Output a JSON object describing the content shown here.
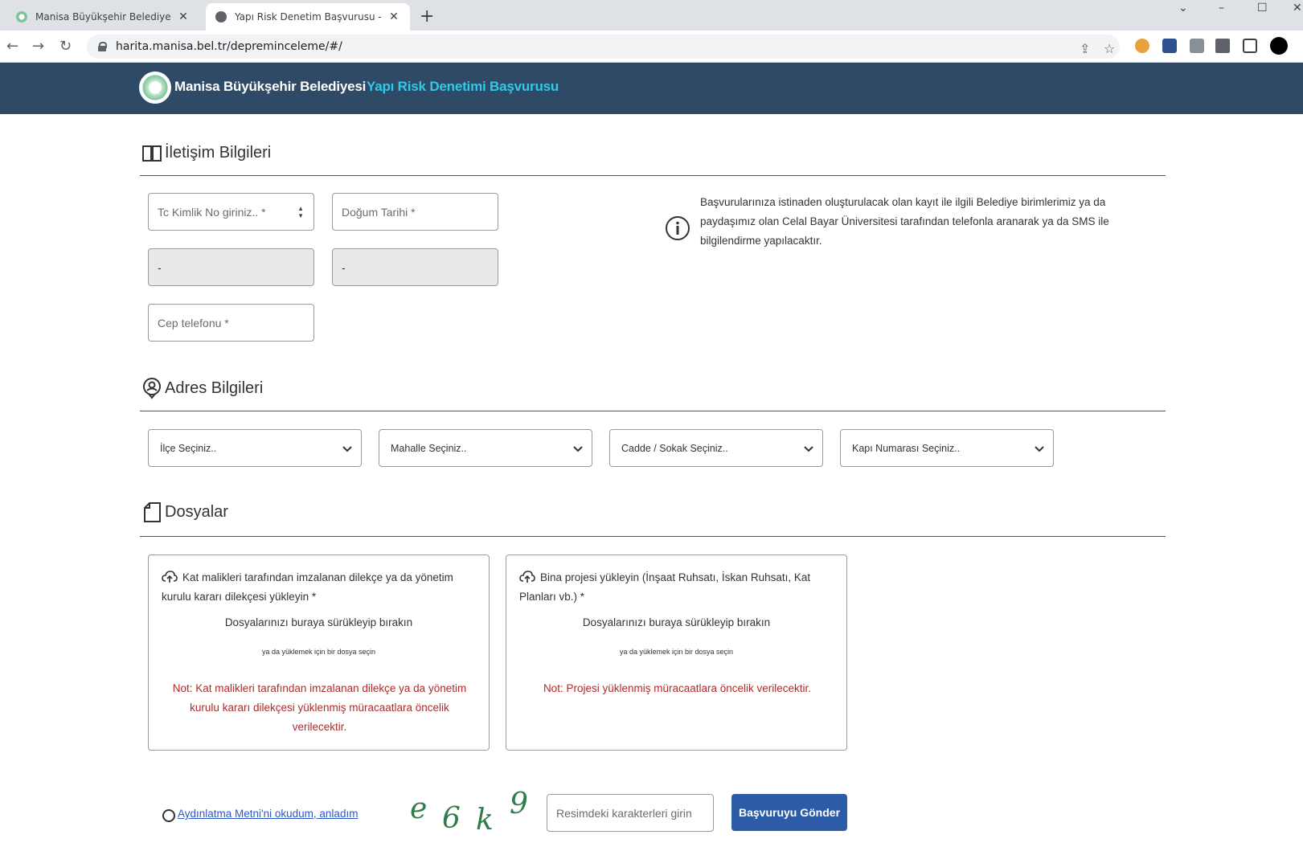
{
  "browser": {
    "tabs": [
      {
        "title": "Manisa Büyükşehir Belediyesi"
      },
      {
        "title": "Yapı Risk Denetim Başvurusu - M"
      }
    ],
    "new_tab": "+",
    "url": "harita.manisa.bel.tr/depreminceleme/#/"
  },
  "header": {
    "brand": "Manisa Büyükşehir Belediyesi",
    "subtitle": "Yapı Risk Denetimi Başvurusu",
    "colors": {
      "bar": "#2e4a66",
      "accent": "#35c7e8"
    }
  },
  "contact": {
    "title": "İletişim Bilgileri",
    "tc_placeholder": "Tc Kimlik No giriniz.. *",
    "birth_placeholder": "Doğum Tarihi *",
    "readonly1": "-",
    "readonly2": "-",
    "phone_placeholder": "Cep telefonu *",
    "info": "Başvurularınıza istinaden oluşturulacak olan kayıt ile ilgili Belediye birimlerimiz ya da paydaşımız olan Celal Bayar Üniversitesi tarafından telefonla aranarak ya da SMS ile bilgilendirme yapılacaktır."
  },
  "address": {
    "title": "Adres Bilgileri",
    "selects": [
      "İlçe Seçiniz..",
      "Mahalle Seçiniz..",
      "Cadde / Sokak Seçiniz..",
      "Kapı Numarası Seçiniz.."
    ]
  },
  "files": {
    "title": "Dosyalar",
    "boxes": [
      {
        "label": "Kat malikleri tarafından imzalanan dilekçe ya da yönetim kurulu kararı dilekçesi yükleyin *",
        "drop": "Dosyalarınızı buraya sürükleyip bırakın",
        "choose": "ya da yüklemek için bir dosya seçin",
        "note": "Not: Kat malikleri tarafından imzalanan dilekçe ya da yönetim kurulu kararı dilekçesi yüklenmiş müracaatlara öncelik verilecektir."
      },
      {
        "label": "Bina projesi yükleyin (İnşaat Ruhsatı, İskan Ruhsatı, Kat Planları vb.) *",
        "drop": "Dosyalarınızı buraya sürükleyip bırakın",
        "choose": "ya da yüklemek için bir dosya seçin",
        "note": "Not: Projesi yüklenmiş müracaatlara öncelik verilecektir."
      }
    ]
  },
  "footer": {
    "consent": "Aydınlatma Metni'ni okudum, anladım",
    "captcha": [
      "e",
      "6",
      "k",
      "9"
    ],
    "captcha_placeholder": "Resimdeki karakterleri girin",
    "submit": "Başvuruyu Gönder"
  }
}
